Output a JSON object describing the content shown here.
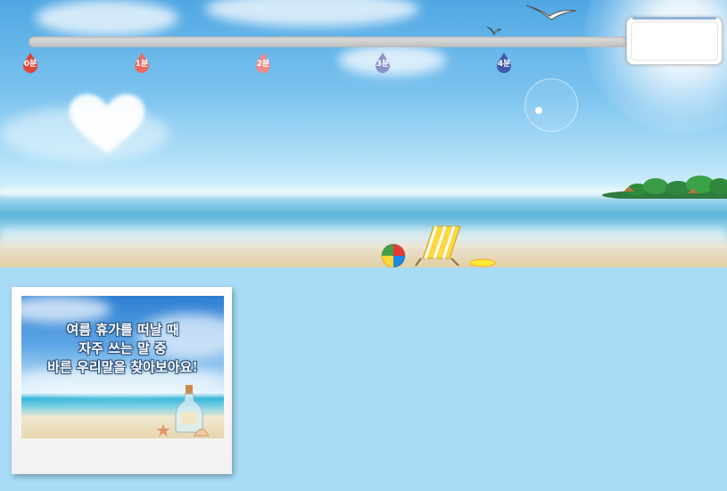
{
  "timeline": {
    "markers": [
      {
        "label": "0분",
        "color": "#e0473a"
      },
      {
        "label": "1분",
        "color": "#e76b63"
      },
      {
        "label": "2분",
        "color": "#ec8a8a"
      },
      {
        "label": "3분",
        "color": "#8a93c8"
      },
      {
        "label": "4분",
        "color": "#3f5aa6"
      }
    ],
    "timer_value": ""
  },
  "card": {
    "title_lines": [
      "여름 휴가를 떠날 때",
      "자주 쓰는 말 중",
      "바른 우리말을 찾아보아요!"
    ]
  }
}
